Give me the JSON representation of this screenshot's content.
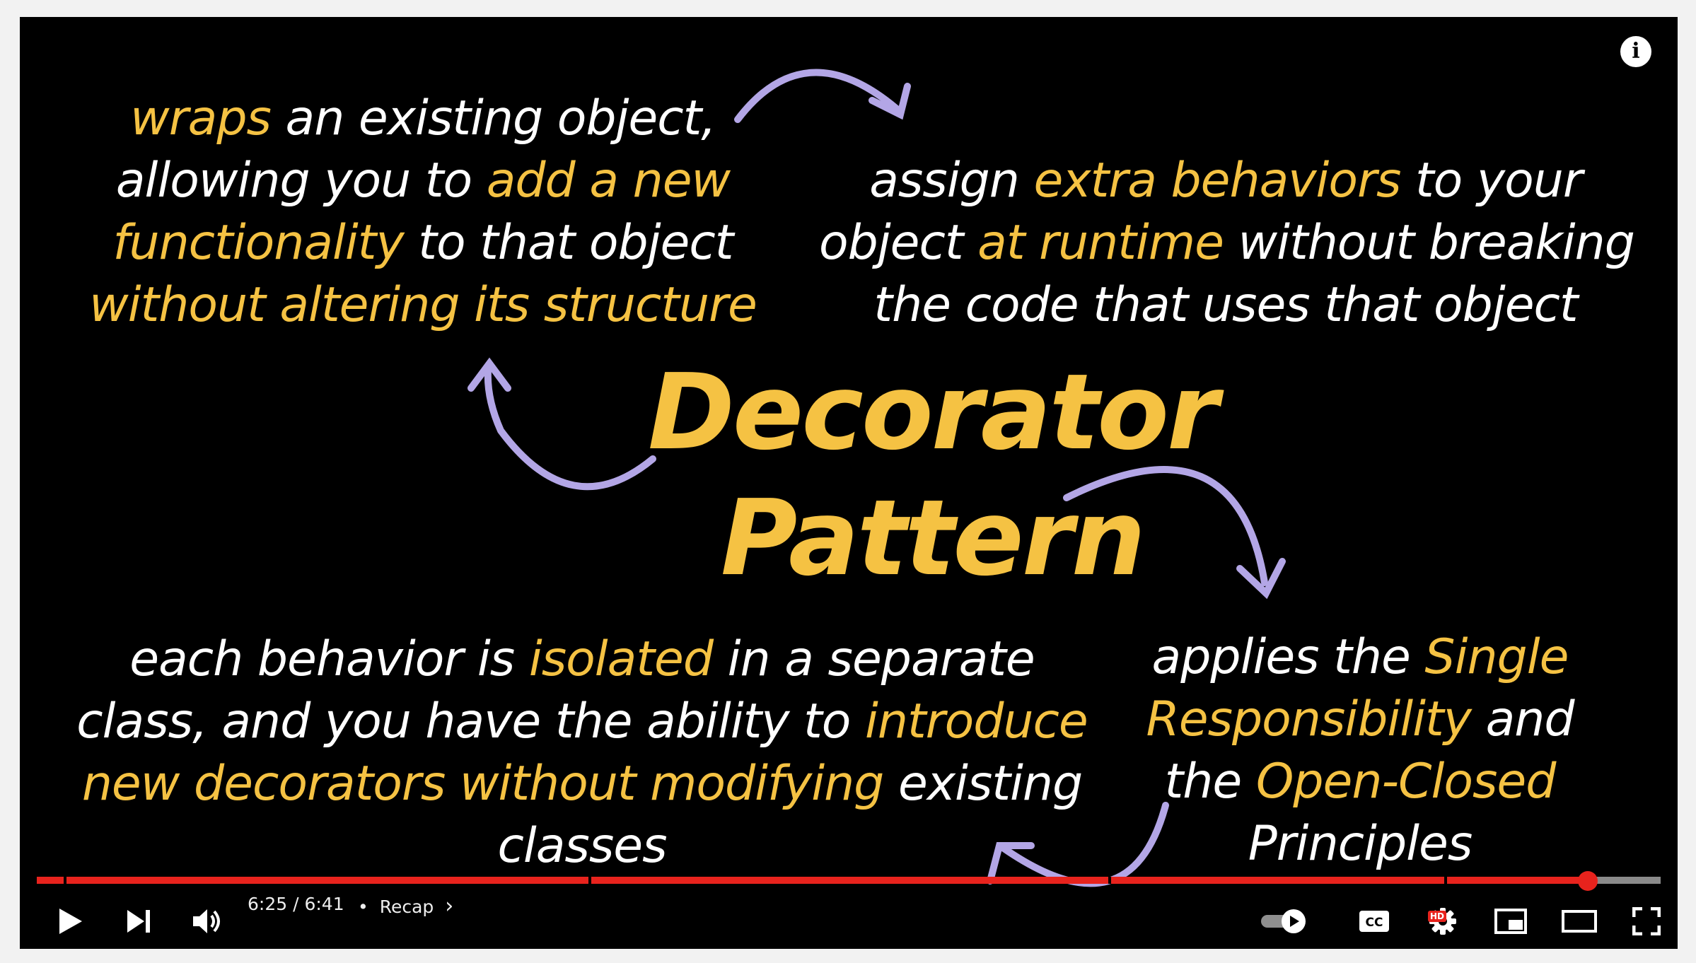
{
  "slide": {
    "title_line1": "Decorator",
    "title_line2": "Pattern",
    "top_left": {
      "l1_y": "wraps",
      "l1_w": " an existing object,",
      "l2_w": "allowing you to ",
      "l2_y": "add a new",
      "l3_y": "functionality",
      "l3_w": " to that object",
      "l4_y": "without altering its structure"
    },
    "top_right": {
      "l1_w1": "assign ",
      "l1_y": "extra behaviors",
      "l1_w2": " to your",
      "l2_w1": "object ",
      "l2_y": "at runtime",
      "l2_w2": " without breaking",
      "l3_w": "the code that uses that object"
    },
    "bottom_left": {
      "l1_w1": "each behavior is ",
      "l1_y": "isolated",
      "l1_w2": " in a separate",
      "l2_w": "class, and you have the ability to ",
      "l2_y": "introduce",
      "l3_y": "new decorators without modifying",
      "l3_w": " existing",
      "l4_w": "classes"
    },
    "bottom_right": {
      "l1_w": "applies the ",
      "l1_y": "Single",
      "l2_y": "Responsibility",
      "l2_w": " and",
      "l3_w": "the ",
      "l3_y": "Open-Closed",
      "l4_w": "Principles"
    }
  },
  "player": {
    "info_label": "i",
    "time_display": "6:25 / 6:41",
    "chapter_separator": "•",
    "chapter_title": "Recap",
    "progress_fraction": 0.955,
    "hd_badge": "HD",
    "icons": [
      "play-icon",
      "next-icon",
      "volume-icon",
      "autoplay-toggle-icon",
      "captions-icon",
      "settings-icon",
      "miniplayer-icon",
      "theater-mode-icon",
      "fullscreen-icon",
      "info-icon"
    ],
    "accent_color": "#e8231d",
    "text_highlight_color": "#f5c243"
  }
}
